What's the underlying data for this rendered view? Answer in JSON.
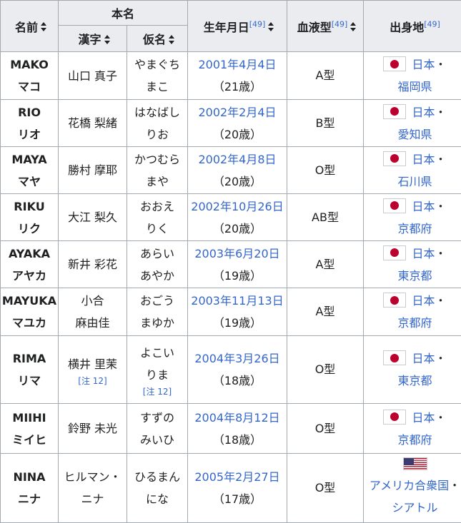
{
  "headers": {
    "name": "名前",
    "honmyo": "本名",
    "kanji": "漢字",
    "kana": "仮名",
    "birth": "生年月日",
    "blood": "血液型",
    "origin": "出身地",
    "ref": "[49]"
  },
  "note_ref": "[注 12]",
  "separator": "・",
  "rows": [
    {
      "name_en": "MAKO",
      "name_kana": "マコ",
      "kanji": [
        "山口 真子"
      ],
      "kana": [
        "やまぐち",
        "まこ"
      ],
      "birth": "2001年4月4日",
      "age": "（21歳）",
      "blood": "A型",
      "flag": "jp",
      "country": "日本",
      "pref": "福岡県"
    },
    {
      "name_en": "RIO",
      "name_kana": "リオ",
      "kanji": [
        "花橋 梨緒"
      ],
      "kana": [
        "はなばし",
        "りお"
      ],
      "birth": "2002年2月4日",
      "age": "（20歳）",
      "blood": "B型",
      "flag": "jp",
      "country": "日本",
      "pref": "愛知県"
    },
    {
      "name_en": "MAYA",
      "name_kana": "マヤ",
      "kanji": [
        "勝村 摩耶"
      ],
      "kana": [
        "かつむら",
        "まや"
      ],
      "birth": "2002年4月8日",
      "age": "（20歳）",
      "blood": "O型",
      "flag": "jp",
      "country": "日本",
      "pref": "石川県"
    },
    {
      "name_en": "RIKU",
      "name_kana": "リク",
      "kanji": [
        "大江 梨久"
      ],
      "kana": [
        "おおえ",
        "りく"
      ],
      "birth": "2002年10月26日",
      "age": "（20歳）",
      "blood": "AB型",
      "flag": "jp",
      "country": "日本",
      "pref": "京都府"
    },
    {
      "name_en": "AYAKA",
      "name_kana": "アヤカ",
      "kanji": [
        "新井 彩花"
      ],
      "kana": [
        "あらい",
        "あやか"
      ],
      "birth": "2003年6月20日",
      "age": "（19歳）",
      "blood": "A型",
      "flag": "jp",
      "country": "日本",
      "pref": "東京都"
    },
    {
      "name_en": "MAYUKA",
      "name_kana": "マユカ",
      "kanji": [
        "小合",
        "麻由佳"
      ],
      "kana": [
        "おごう",
        "まゆか"
      ],
      "birth": "2003年11月13日",
      "age": "（19歳）",
      "blood": "A型",
      "flag": "jp",
      "country": "日本",
      "pref": "京都府"
    },
    {
      "name_en": "RIMA",
      "name_kana": "リマ",
      "kanji": [
        "横井 里茉"
      ],
      "kana": [
        "よこい",
        "りま"
      ],
      "birth": "2004年3月26日",
      "age": "（18歳）",
      "blood": "O型",
      "flag": "jp",
      "country": "日本",
      "pref": "東京都",
      "note": true
    },
    {
      "name_en": "MIIHI",
      "name_kana": "ミイヒ",
      "kanji": [
        "鈴野 未光"
      ],
      "kana": [
        "すずの",
        "みいひ"
      ],
      "birth": "2004年8月12日",
      "age": "（18歳）",
      "blood": "O型",
      "flag": "jp",
      "country": "日本",
      "pref": "京都府"
    },
    {
      "name_en": "NINA",
      "name_kana": "ニナ",
      "kanji": [
        "ヒルマン・",
        "ニナ"
      ],
      "kana": [
        "ひるまん",
        "にな"
      ],
      "birth": "2005年2月27日",
      "age": "（17歳）",
      "blood": "O型",
      "flag": "us",
      "country": "アメリカ合衆国",
      "pref": "シアトル"
    }
  ]
}
